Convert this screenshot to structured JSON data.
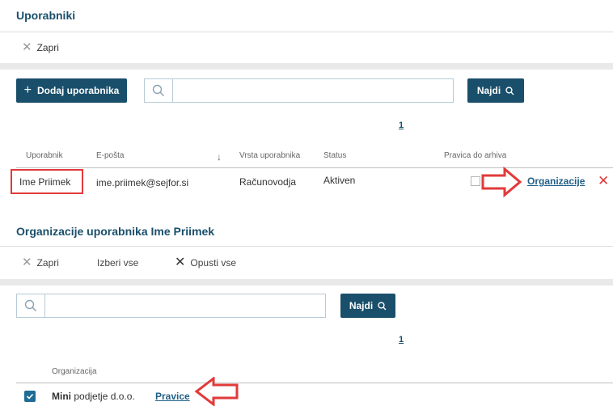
{
  "users_panel": {
    "title": "Uporabniki",
    "close_label": "Zapri",
    "add_button_label": "Dodaj uporabnika",
    "search_placeholder": "",
    "search_button_label": "Najdi",
    "page_number": "1",
    "columns": [
      "Uporabnik",
      "E-pošta",
      "Vrsta uporabnika",
      "Status",
      "Pravica do arhiva"
    ],
    "sort_arrow": "↓",
    "row": {
      "name": "Ime Priimek",
      "email": "ime.priimek@sejfor.si",
      "type": "Računovodja",
      "status": "Aktiven",
      "archive_right": false,
      "organizations_link": "Organizacije"
    }
  },
  "orgs_panel": {
    "title": "Organizacije uporabnika Ime Priimek",
    "close_label": "Zapri",
    "select_all_label": "Izberi vse",
    "deselect_all_label": "Opusti vse",
    "search_placeholder": "",
    "search_button_label": "Najdi",
    "page_number": "1",
    "column_header": "Organizacija",
    "row": {
      "checked": true,
      "org_name_bold": "Mini",
      "org_name_rest": "podjetje d.o.o.",
      "rights_link": "Pravice"
    }
  },
  "colors": {
    "primary": "#1a4f6b",
    "link": "#1f5f86",
    "annotation_red": "#e23a3a",
    "delete_red": "#e23a3a",
    "checkbox_blue": "#1f6d96"
  }
}
